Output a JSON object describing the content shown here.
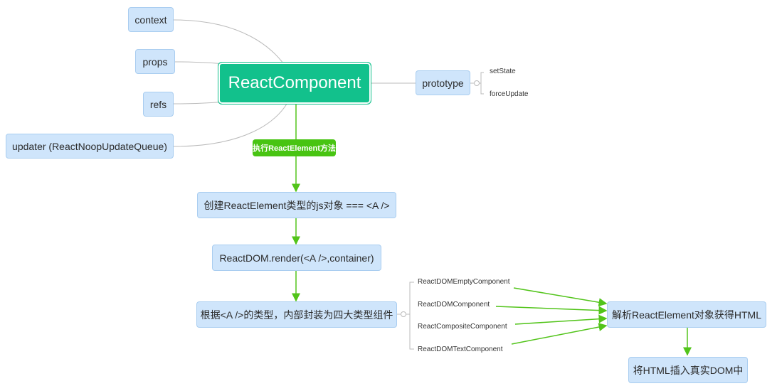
{
  "root": {
    "label": "ReactComponent"
  },
  "left_nodes": [
    {
      "label": "context"
    },
    {
      "label": "props"
    },
    {
      "label": "refs"
    },
    {
      "label": "updater (ReactNoopUpdateQueue)"
    }
  ],
  "prototype": {
    "label": "prototype",
    "children": [
      "setState",
      "forceUpdate"
    ]
  },
  "edge_tag": {
    "label": "执行ReactElement方法"
  },
  "flow": [
    {
      "label": "创建ReactElement类型的js对象 === <A />"
    },
    {
      "label": "ReactDOM.render(<A />,container)"
    },
    {
      "label": "根据<A />的类型，内部封装为四大类型组件"
    }
  ],
  "component_types": [
    "ReactDOMEmptyComponent",
    "ReactDOMComponent",
    "ReactCompositeComponent",
    "ReactDOMTextComponent"
  ],
  "parse_node": {
    "label": "解析ReactElement对象获得HTML"
  },
  "insert_node": {
    "label": "将HTML插入真实DOM中"
  },
  "colors": {
    "accent": "#12c18c",
    "arrow": "#52c41a",
    "node_fill": "#cfe5fb",
    "line": "#bbbbbb"
  }
}
